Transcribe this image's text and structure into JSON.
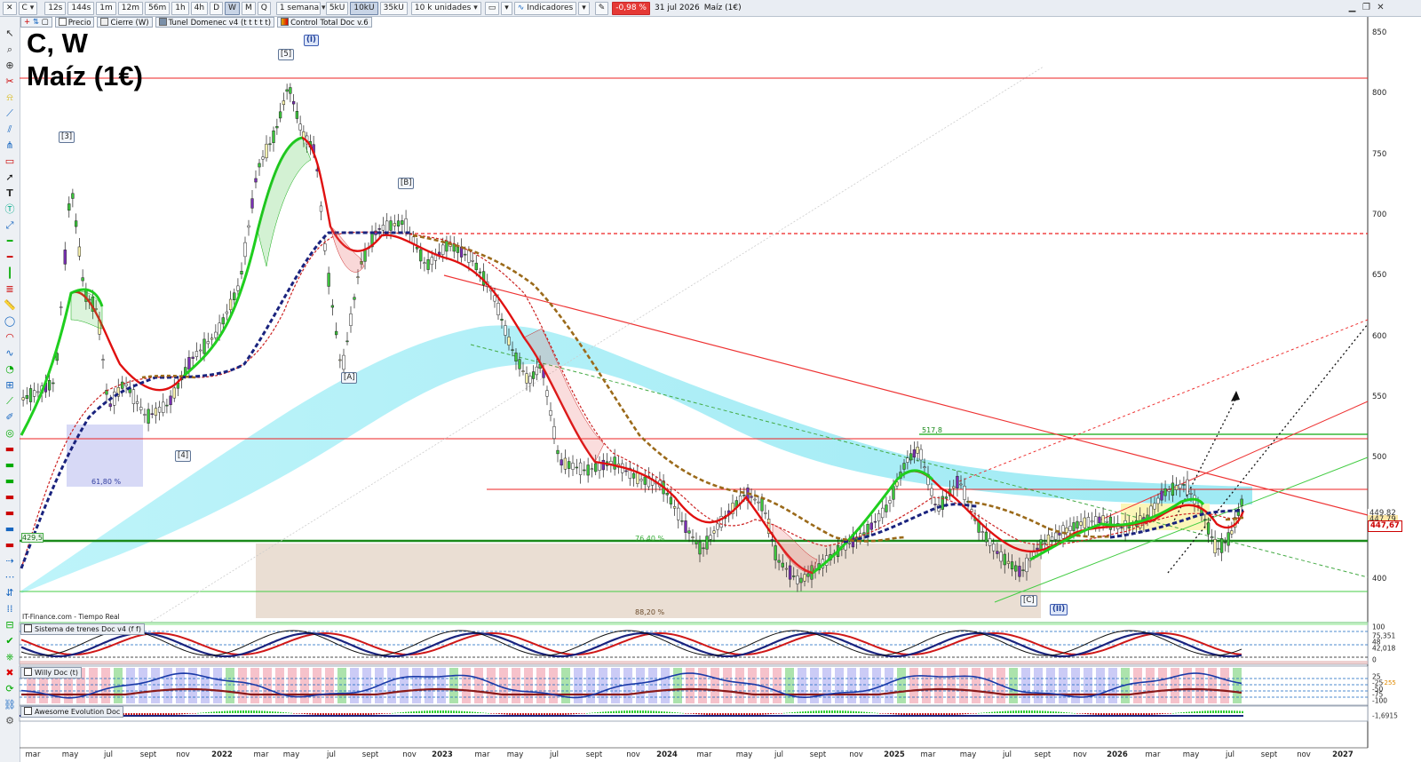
{
  "toolbar": {
    "symbol": "C",
    "timeframes": [
      "12s",
      "144s",
      "1m",
      "12m",
      "56m",
      "1h",
      "4h",
      "D",
      "W",
      "M",
      "Q"
    ],
    "active_timeframe": "W",
    "period": "1 semana",
    "units": [
      "5kU",
      "10kU",
      "35kU"
    ],
    "active_unit": "10kU",
    "volume_mode": "10 k unidades",
    "indicators_label": "Indicadores",
    "change_badge": "-0,98 %",
    "date": "31 jul 2026",
    "instrument_name": "Maíz (1€)"
  },
  "legend": [
    "Precio",
    "Cierre (W)",
    "Tunel Domenec v4 (t t t t t)",
    "Control Total Doc v.6"
  ],
  "title": {
    "line1": "C, W",
    "line2": "Maíz (1€)"
  },
  "source_note": "IT-Finance.com - Tiempo Real",
  "panes": [
    "Sistema de trenes Doc v4 (f f)",
    "Willy Doc (t)",
    "Awesome Evolution Doc"
  ],
  "y_axis": {
    "labels": [
      "850",
      "800",
      "750",
      "700",
      "650",
      "600",
      "550",
      "500",
      "450",
      "400"
    ]
  },
  "x_axis": {
    "labels": [
      "mar",
      "may",
      "jul",
      "sept",
      "nov",
      "2022",
      "mar",
      "may",
      "jul",
      "sept",
      "nov",
      "2023",
      "mar",
      "may",
      "jul",
      "sept",
      "nov",
      "2024",
      "mar",
      "may",
      "jul",
      "sept",
      "nov",
      "2025",
      "mar",
      "may",
      "jul",
      "sept",
      "nov",
      "2026",
      "mar",
      "may",
      "jul",
      "sept",
      "nov",
      "2027"
    ],
    "years": [
      "2022",
      "2023",
      "2024",
      "2025",
      "2026",
      "2027"
    ]
  },
  "wave_labels": {
    "w3": "[3]",
    "w5": "[5]",
    "wI": "(I)",
    "wB": "[B]",
    "wA": "[A]",
    "w4": "[4]",
    "wC": "[C]",
    "wII": "(II)"
  },
  "annotations": {
    "fib_618": "61,80 %",
    "fib_764": "76,40 %",
    "fib_882": "88,20 %",
    "level_4295": "429,5",
    "level_5178": "517,8"
  },
  "price_tags": {
    "last": "447,67",
    "tag_a": "449,82",
    "tag_b": "447,79"
  },
  "sub_axis": {
    "trenes": [
      "100",
      "75,351",
      "48",
      "42,018",
      "0"
    ],
    "willy": [
      "25",
      "-25",
      "-50",
      "-75",
      "-100"
    ],
    "willy_extra": "-255",
    "awesome": [
      "-1,6915"
    ]
  },
  "colors": {
    "bull": "#f3e85b",
    "bear": "#7a2fb5",
    "green_line": "#1fcf1f",
    "red_line": "#e01010",
    "navy": "#1a237e",
    "brown": "#9b6a1a",
    "cloud": "#7fe3f0"
  }
}
